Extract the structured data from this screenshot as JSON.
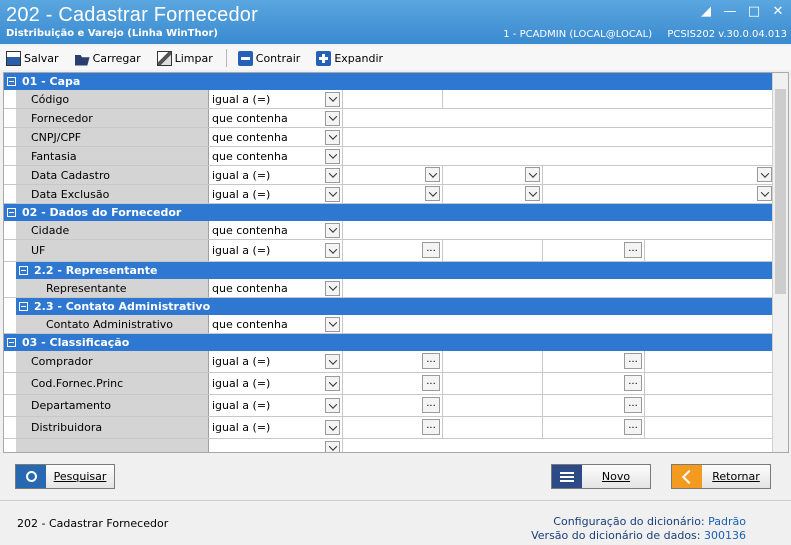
{
  "window": {
    "title": "202 - Cadastrar  Fornecedor",
    "subtitle": "Distribuição e Varejo (Linha WinThor)",
    "user_session": "1 - PCADMIN (LOCAL@LOCAL)",
    "routine_version": "PCSIS202  v.30.0.04.013"
  },
  "toolbar": {
    "save": "Salvar",
    "load": "Carregar",
    "clear": "Limpar",
    "collapse": "Contrair",
    "expand": "Expandir"
  },
  "sections": {
    "capa": "01 - Capa",
    "dados": "02 - Dados do Fornecedor",
    "representante": "2.2 - Representante",
    "contato": "2.3 - Contato Administrativo",
    "classificacao": "03 - Classificação"
  },
  "rows": {
    "codigo": {
      "label": "Código",
      "op": "igual a (=)"
    },
    "fornecedor": {
      "label": "Fornecedor",
      "op": "que contenha"
    },
    "cnpj": {
      "label": "CNPJ/CPF",
      "op": "que contenha"
    },
    "fantasia": {
      "label": "Fantasia",
      "op": "que contenha"
    },
    "data_cadastro": {
      "label": "Data Cadastro",
      "op": "igual a (=)"
    },
    "data_exclusao": {
      "label": "Data Exclusão",
      "op": "igual a (=)"
    },
    "cidade": {
      "label": "Cidade",
      "op": "que contenha"
    },
    "uf": {
      "label": "UF",
      "op": "igual a (=)"
    },
    "representante": {
      "label": "Representante",
      "op": "que contenha"
    },
    "contato_adm": {
      "label": "Contato Administrativo",
      "op": "que contenha"
    },
    "comprador": {
      "label": "Comprador",
      "op": "igual a (=)"
    },
    "cod_fornec_princ": {
      "label": "Cod.Fornec.Princ",
      "op": "igual a (=)"
    },
    "departamento": {
      "label": "Departamento",
      "op": "igual a (=)"
    },
    "distribuidora": {
      "label": "Distribuidora",
      "op": "igual a (=)"
    }
  },
  "ellipsis": "...",
  "buttons": {
    "search": "Pesquisar",
    "new": "Novo",
    "back": "Retornar"
  },
  "footer": {
    "routine": "202 - Cadastrar  Fornecedor",
    "dict_config_label": "Configuração do dicionário:",
    "dict_config_value": "Padrão",
    "dict_version_label": "Versão do dicionário de dados:",
    "dict_version_value": "300136"
  }
}
